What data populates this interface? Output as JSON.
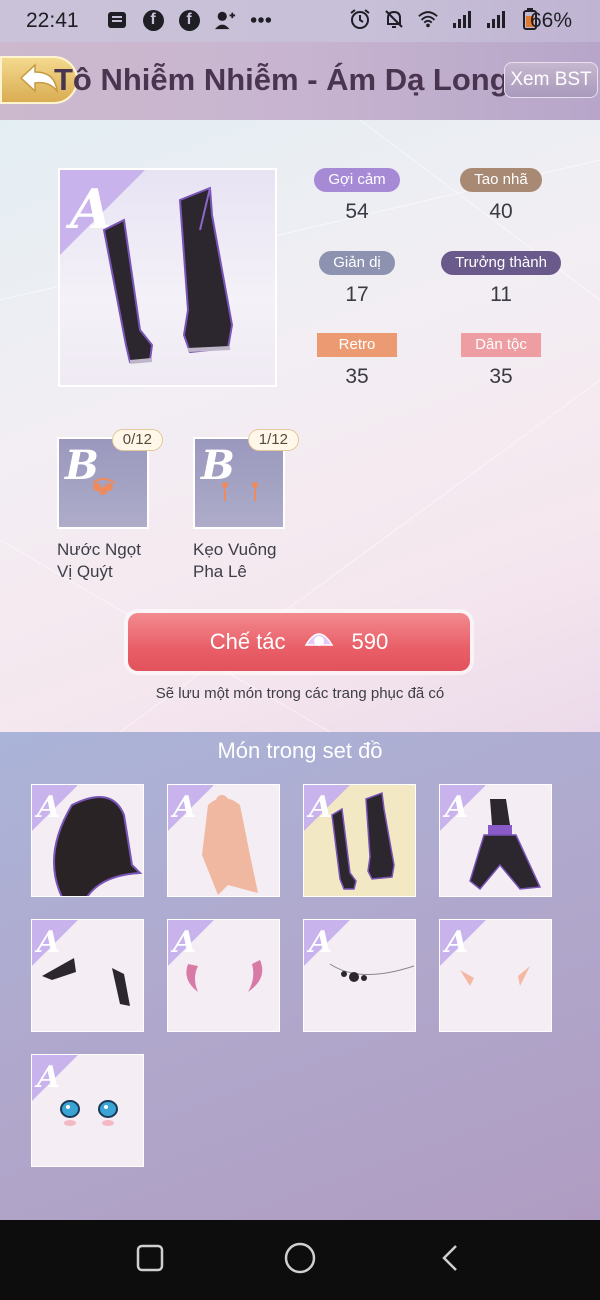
{
  "status_bar": {
    "time": "22:41",
    "battery": "66%",
    "icons_left": [
      "message-icon",
      "facebook-icon",
      "facebook-icon",
      "add-contact-icon",
      "more-dots-icon"
    ],
    "icons_right": [
      "alarm-icon",
      "mute-icon",
      "wifi-icon",
      "signal-icon",
      "signal-icon",
      "battery-icon"
    ]
  },
  "header": {
    "title": "Tô Nhiễm Nhiễm - Ám Dạ Long Vũ",
    "back_icon": "back-arrow-icon",
    "collection_button": "Xem BST"
  },
  "item": {
    "rank": "A",
    "image": "black-boots"
  },
  "stats": [
    {
      "label": "Gợi cảm",
      "value": "54",
      "color": "#a78ad6",
      "shape": "pill"
    },
    {
      "label": "Tao nhã",
      "value": "40",
      "color": "#a88a74",
      "shape": "pill"
    },
    {
      "label": "Giản dị",
      "value": "17",
      "color": "#8c92b0",
      "shape": "pill"
    },
    {
      "label": "Trưởng thành",
      "value": "11",
      "color": "#6a5a8c",
      "shape": "pill"
    },
    {
      "label": "Retro",
      "value": "35",
      "color": "#ec9a72",
      "shape": "rect"
    },
    {
      "label": "Dân tộc",
      "value": "35",
      "color": "#ee9ea2",
      "shape": "rect"
    }
  ],
  "materials": [
    {
      "rank": "B",
      "count": "0/12",
      "name_line1": "Nước Ngọt",
      "name_line2": "Vị Quýt"
    },
    {
      "rank": "B",
      "count": "1/12",
      "name_line1": "Kẹo Vuông",
      "name_line2": "Pha Lê"
    }
  ],
  "craft": {
    "label": "Chế tác",
    "cost": "590",
    "currency_icon": "pearl-shell-icon",
    "note": "Sẽ lưu một món trong các trang phục đã có"
  },
  "set": {
    "title": "Món trong set đồ",
    "items": [
      {
        "rank": "A",
        "image": "dark-cloak",
        "selected": false
      },
      {
        "rank": "A",
        "image": "long-pink-hair",
        "selected": false
      },
      {
        "rank": "A",
        "image": "black-boots",
        "selected": true
      },
      {
        "rank": "A",
        "image": "black-purple-dress",
        "selected": false
      },
      {
        "rank": "A",
        "image": "black-gloves",
        "selected": false
      },
      {
        "rank": "A",
        "image": "pink-horns",
        "selected": false
      },
      {
        "rank": "A",
        "image": "bead-necklace",
        "selected": false
      },
      {
        "rank": "A",
        "image": "elf-ears",
        "selected": false
      },
      {
        "rank": "A",
        "image": "blue-eyes",
        "selected": false
      }
    ]
  },
  "nav": {
    "buttons": [
      "recents-icon",
      "home-icon",
      "back-icon"
    ]
  }
}
